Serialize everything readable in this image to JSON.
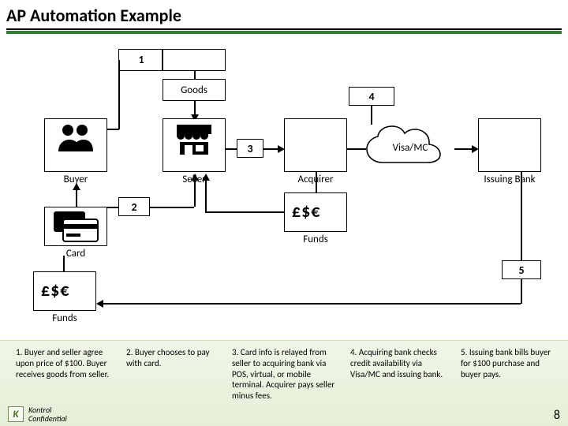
{
  "title": "AP Automation Example",
  "diagram": {
    "entities": {
      "buyer": "Buyer",
      "seller": "Seller",
      "acquirer": "Acquirer",
      "network": "Visa/MC",
      "issuing_bank": "Issuing Bank"
    },
    "labels": {
      "goods": "Goods",
      "card": "Card",
      "funds": "Funds",
      "currency": "£$€"
    },
    "steps": [
      {
        "num": "1",
        "text": "1. Buyer and seller agree upon price of $100. Buyer receives goods from seller."
      },
      {
        "num": "2",
        "text": "2. Buyer chooses to pay with card."
      },
      {
        "num": "3",
        "text": "3. Card info is relayed from seller to acquiring bank via POS, virtual, or mobile terminal. Acquirer pays seller minus fees."
      },
      {
        "num": "4",
        "text": "4. Acquiring bank checks credit availability via Visa/MC and issuing bank."
      },
      {
        "num": "5",
        "text": "5. Issuing bank bills buyer for $100 purchase and buyer pays."
      }
    ]
  },
  "footer": {
    "brand": "Kontrol",
    "confidential": "Confidential",
    "page": "8"
  }
}
